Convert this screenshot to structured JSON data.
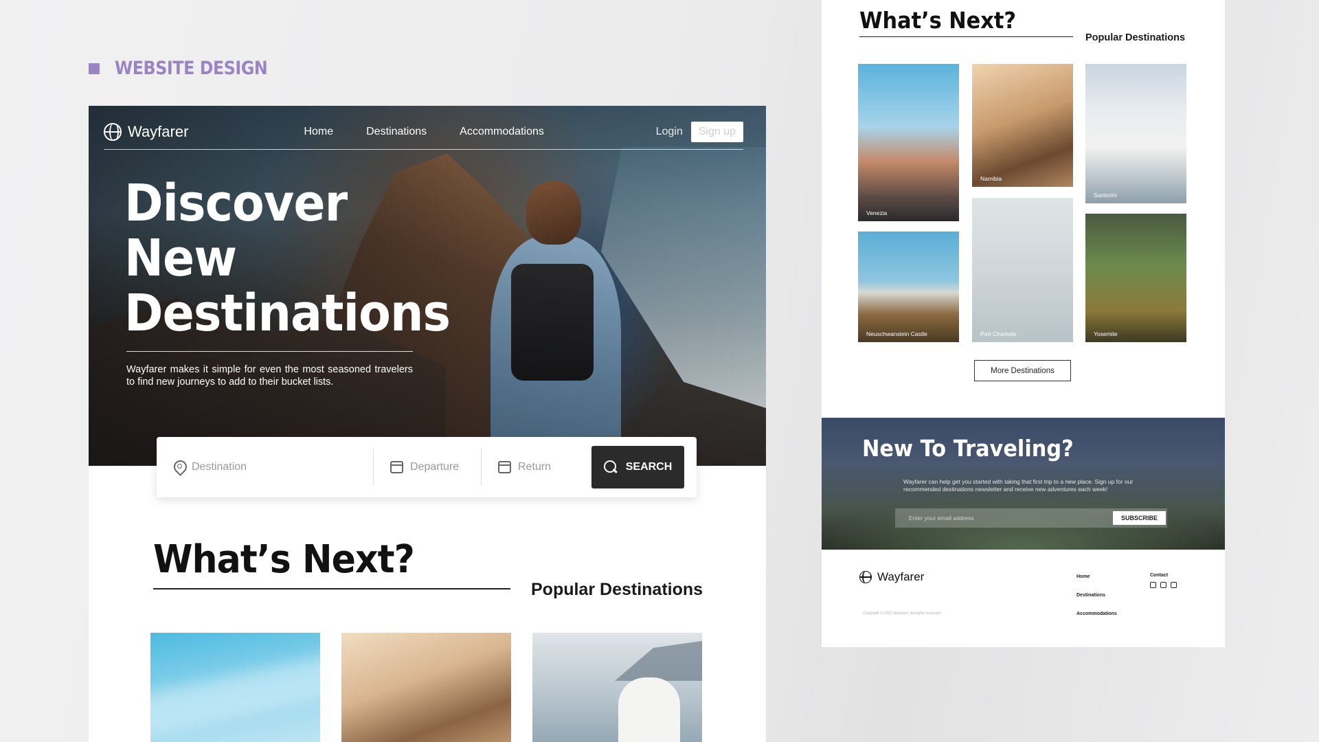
{
  "section_label": "WEBSITE DESIGN",
  "site": {
    "brand": "Wayfarer",
    "nav": {
      "home": "Home",
      "destinations": "Destinations",
      "accommodations": "Accommodations",
      "login": "Login",
      "signup": "Sign up"
    },
    "hero": {
      "title_lines": [
        "Discover",
        "New",
        "Destinations"
      ],
      "subtitle": "Wayfarer makes it simple for even the most seasoned travelers to find new journeys to add to their bucket lists."
    },
    "search": {
      "destination": "Destination",
      "departure": "Departure",
      "return": "Return",
      "button": "SEARCH"
    },
    "whats_next": {
      "title": "What’s Next?",
      "subtitle": "Popular Destinations"
    }
  },
  "right": {
    "title": "What’s Next?",
    "subtitle": "Popular Destinations",
    "destinations": [
      "Venezia",
      "Namibia",
      "Santorini",
      "Neuschwanstein Castle",
      "Port Charlotte",
      "Yosemite"
    ],
    "more_button": "More Destinations",
    "newsletter": {
      "title": "New To Traveling?",
      "text": "Wayfarer can help get you started with taking that first trip to a new place. Sign up for our recommended destinations newsletter and receive new adventures each week!",
      "placeholder": "Enter your email address",
      "button": "SUBSCRIBE"
    },
    "footer": {
      "brand": "Wayfarer",
      "copyright": "Copyright © 2022 Wayfarer. All rights reserved.",
      "links": [
        "Home",
        "Destinations",
        "Accommodations"
      ],
      "contact": "Contact",
      "social_icons": [
        "instagram-icon",
        "twitter-icon",
        "facebook-icon"
      ]
    }
  },
  "colors": {
    "accent": "#9a84c4",
    "button_dark": "#2b2b2b"
  }
}
